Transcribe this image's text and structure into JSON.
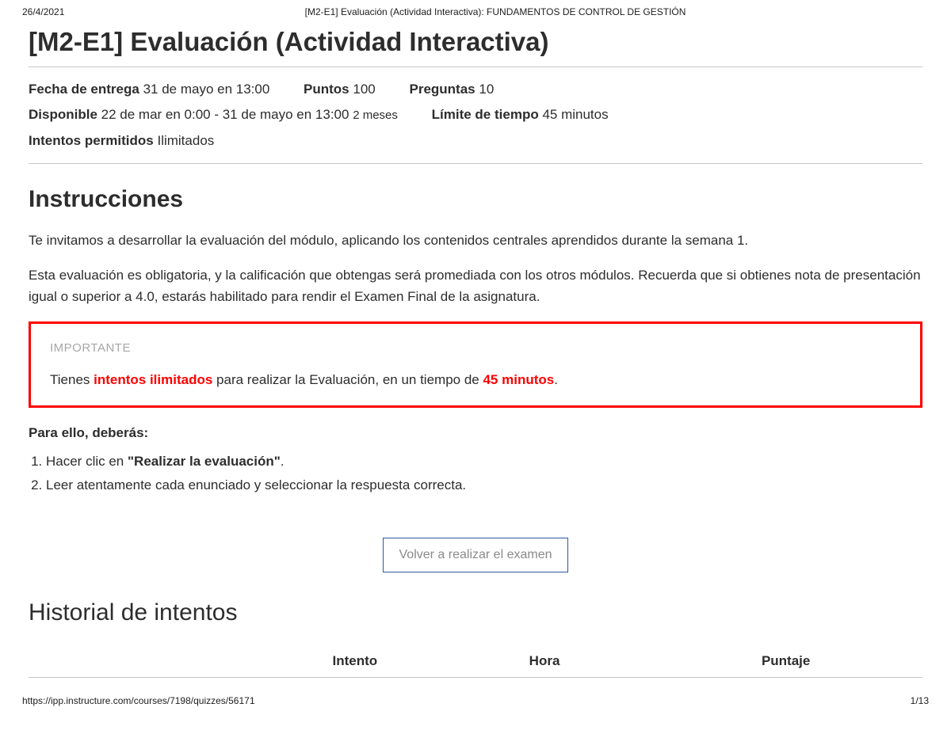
{
  "print_header": {
    "date": "26/4/2021",
    "doc_title": "[M2-E1] Evaluación (Actividad Interactiva): FUNDAMENTOS DE CONTROL DE GESTIÓN"
  },
  "page_title": "[M2-E1] Evaluación (Actividad Interactiva)",
  "meta": {
    "due_label": "Fecha de entrega",
    "due_value": "31 de mayo en 13:00",
    "points_label": "Puntos",
    "points_value": "100",
    "questions_label": "Preguntas",
    "questions_value": "10",
    "available_label": "Disponible",
    "available_value": "22 de mar en 0:00 - 31 de mayo en 13:00",
    "available_duration": "2 meses",
    "time_limit_label": "Límite de tiempo",
    "time_limit_value": "45 minutos",
    "attempts_label": "Intentos permitidos",
    "attempts_value": "Ilimitados"
  },
  "instructions": {
    "heading": "Instrucciones",
    "p1": "Te invitamos a desarrollar la evaluación del módulo, aplicando los contenidos centrales aprendidos durante la semana 1.",
    "p2": "Esta evaluación es obligatoria, y la calificación que obtengas será promediada con los otros módulos. Recuerda que si obtienes nota de presentación igual o superior a 4.0, estarás habilitado para rendir el Examen Final de la asignatura.",
    "important_label": "IMPORTANTE",
    "important_pre": "Tienes ",
    "important_bold1": "intentos ilimitados",
    "important_mid": " para realizar la Evaluación, en un tiempo de ",
    "important_bold2": "45 minutos",
    "important_post": ".",
    "subhead": "Para ello, deberás:",
    "step1_pre": "Hacer clic en ",
    "step1_bold": "\"Realizar la evaluación\"",
    "step1_post": ".",
    "step2": "Leer atentamente cada enunciado y seleccionar la respuesta correcta."
  },
  "retake_button": "Volver a realizar el examen",
  "history": {
    "heading": "Historial de intentos",
    "col_intento": "Intento",
    "col_hora": "Hora",
    "col_puntaje": "Puntaje"
  },
  "print_footer": {
    "url": "https://ipp.instructure.com/courses/7198/quizzes/56171",
    "page": "1/13"
  }
}
